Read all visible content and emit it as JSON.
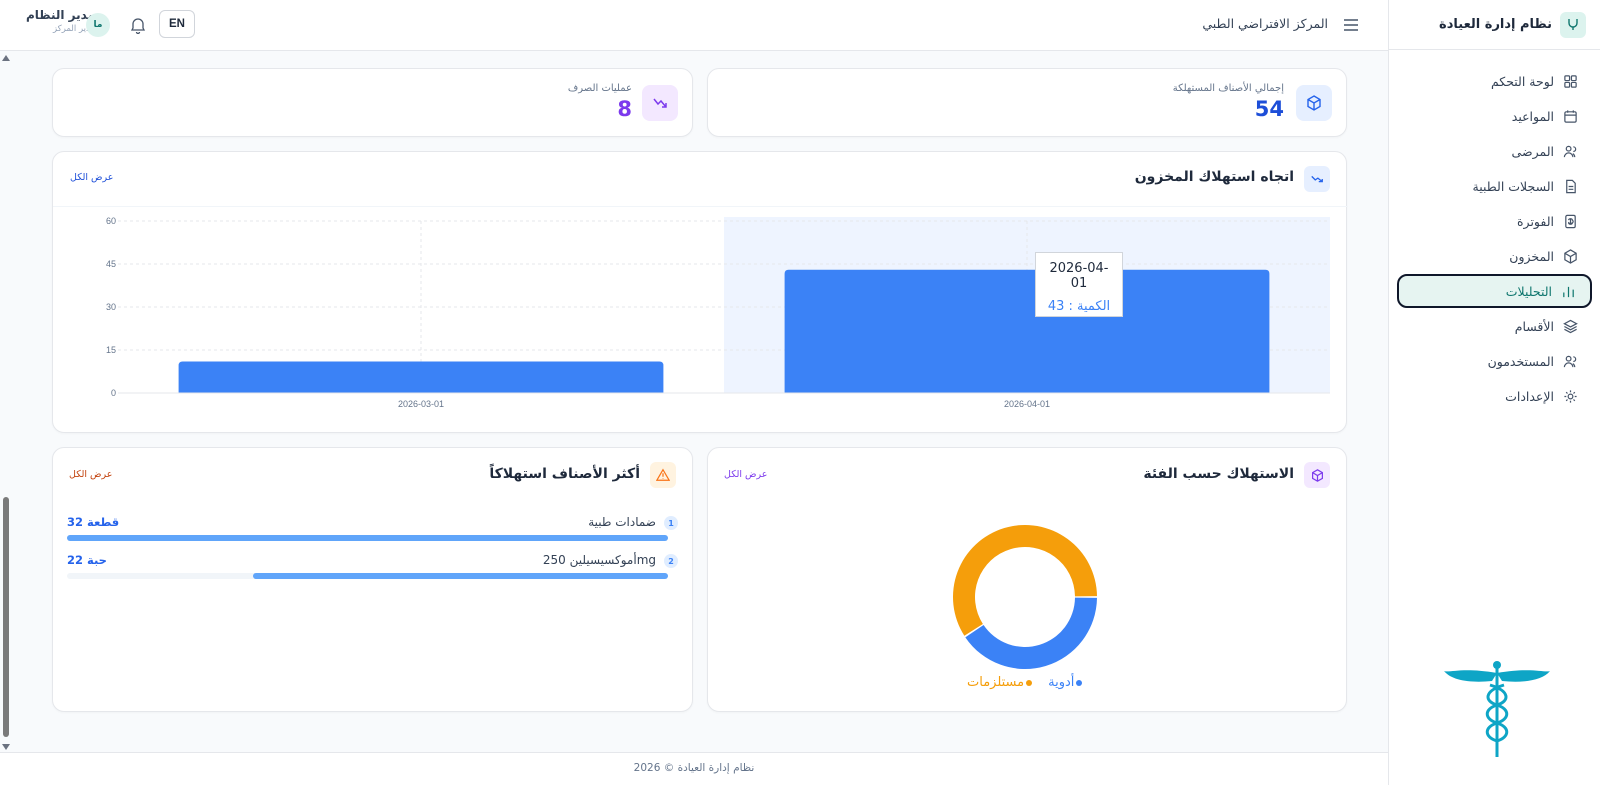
{
  "sidebar": {
    "brand_title": "نظام إدارة العيادة",
    "items": [
      {
        "label": "لوحة التحكم",
        "icon": "dashboard-icon"
      },
      {
        "label": "المواعيد",
        "icon": "calendar-icon"
      },
      {
        "label": "المرضى",
        "icon": "users-icon"
      },
      {
        "label": "السجلات الطبية",
        "icon": "document-icon"
      },
      {
        "label": "الفوترة",
        "icon": "invoice-icon"
      },
      {
        "label": "المخزون",
        "icon": "box-icon"
      },
      {
        "label": "التحليلات",
        "icon": "bar-chart-icon",
        "active": true
      },
      {
        "label": "الأقسام",
        "icon": "layers-icon"
      },
      {
        "label": "المستخدمون",
        "icon": "user-group-icon"
      },
      {
        "label": "الإعدادات",
        "icon": "gear-icon"
      }
    ]
  },
  "topbar": {
    "center_name": "المركز الافتراضي الطبي",
    "user_name": "مدير النظام",
    "user_role": "مدير المركز",
    "avatar_initials": "ما",
    "lang_button": "EN"
  },
  "stats": {
    "total_consumed_label": "إجمالي الأصناف المستهلكة",
    "total_consumed_value": "54",
    "dispense_ops_label": "عمليات الصرف",
    "dispense_ops_value": "8"
  },
  "trend_card": {
    "title": "اتجاه استهلاك المخزون",
    "view_all": "عرض الكل",
    "tooltip_date": "2026-04-01",
    "tooltip_value": "الكمية : 43"
  },
  "category_card": {
    "title": "الاستهلاك حسب الفئة",
    "view_all": "عرض الكل"
  },
  "top_items_card": {
    "title": "أكثر الأصناف استهلاكاً",
    "view_all": "عرض الكل",
    "items": [
      {
        "rank": "1",
        "name": "ضمادات طبية",
        "value": "32 قطعة",
        "fraction": 1.0
      },
      {
        "rank": "2",
        "name": "أموكسيسيلين 250mg",
        "value": "22 حبة",
        "fraction": 0.69
      }
    ]
  },
  "footer": {
    "text": "نظام إدارة العيادة © 2026"
  },
  "colors": {
    "accent": "#0f766e",
    "bar_blue": "#3b82f6",
    "orange": "#f59e0b",
    "purple": "#7c3aed"
  },
  "chart_data": [
    {
      "type": "bar",
      "categories": [
        "2026-03-01",
        "2026-04-01"
      ],
      "values": [
        11,
        43
      ],
      "ylim": [
        0,
        60
      ],
      "yticks": [
        0,
        15,
        30,
        45,
        60
      ],
      "grid": true
    },
    {
      "type": "pie",
      "variant": "donut",
      "labels": [
        "أدوية",
        "مستلزمات"
      ],
      "values": [
        22,
        32
      ],
      "colors": [
        "#3b82f6",
        "#f59e0b"
      ]
    }
  ]
}
